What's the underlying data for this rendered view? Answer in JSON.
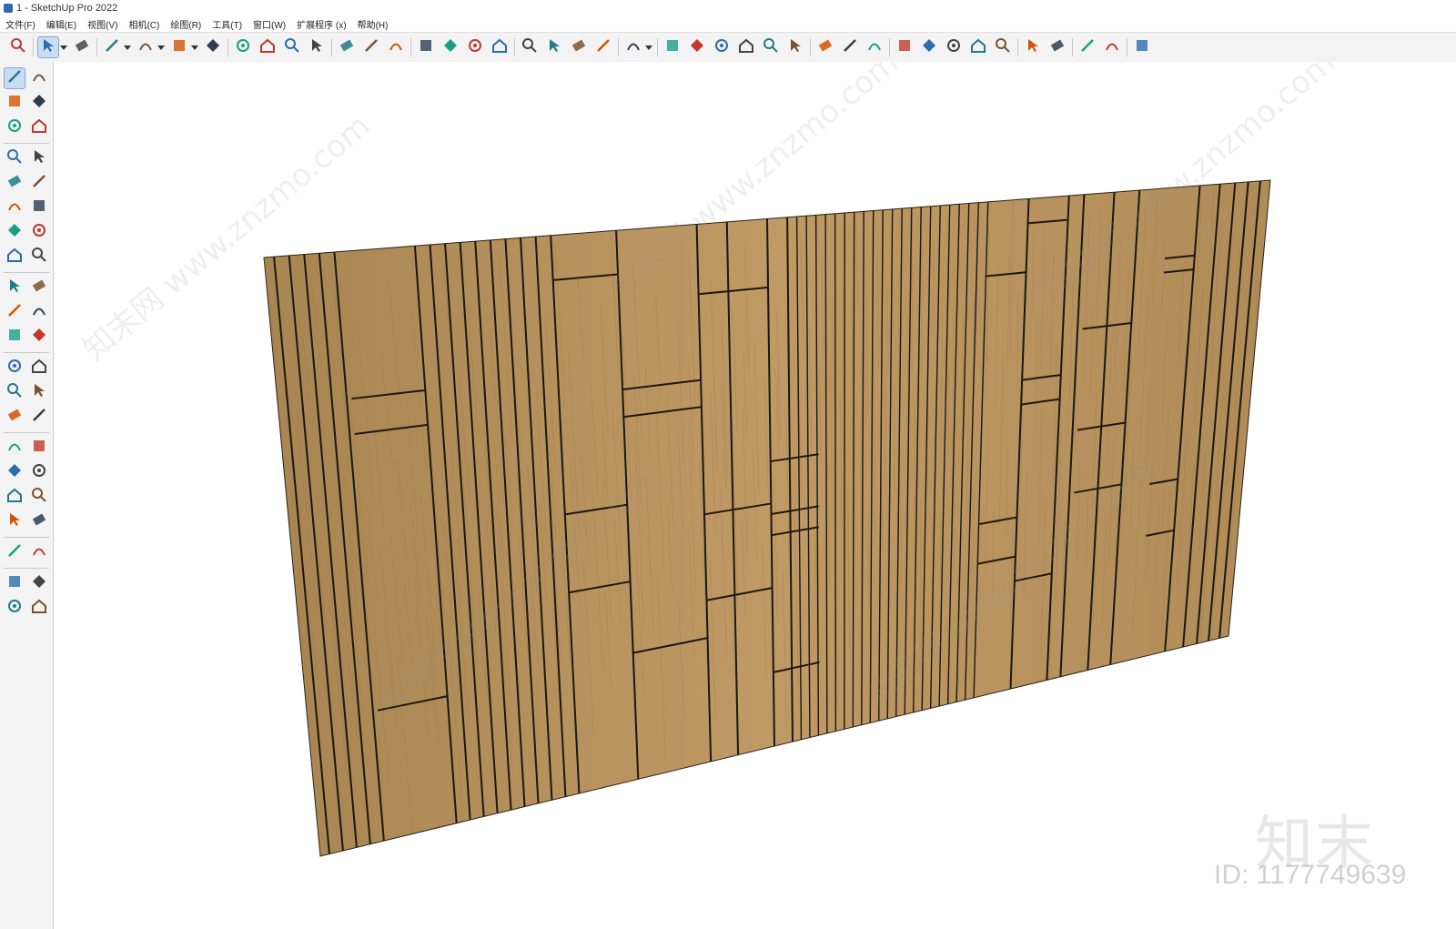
{
  "window": {
    "title": "1 - SketchUp Pro 2022"
  },
  "menu": [
    "文件(F)",
    "编辑(E)",
    "视图(V)",
    "相机(C)",
    "绘图(R)",
    "工具(T)",
    "窗口(W)",
    "扩展程序 (x)",
    "帮助(H)"
  ],
  "toolbar": {
    "icons": [
      "zoom-extents-icon",
      "select-icon",
      "eraser-icon",
      "line-icon",
      "arc-icon",
      "rectangle-icon",
      "push-pull-icon",
      "follow-me-icon",
      "move-icon",
      "rotate-icon",
      "scale-icon",
      "tape-measure-icon",
      "text-icon",
      "paint-bucket-icon",
      "orbit-icon",
      "pan-icon",
      "zoom-icon",
      "zoom-window-icon",
      "components-icon",
      "styles-icon",
      "layers-icon",
      "scenes-icon",
      "account-icon",
      "iso-view-icon",
      "front-view-icon",
      "home-view-icon",
      "top-view-icon",
      "house-icon",
      "box-icon",
      "solid-tools-icon",
      "outer-shell-icon",
      "intersect-icon",
      "add-location-icon",
      "sandbox-icon",
      "photo-texture-icon",
      "shadow-icon",
      "cloud-icon",
      "extension-manager-icon",
      "section-icon",
      "info-icon",
      "warehouse-icon",
      "user-icon"
    ]
  },
  "left_toolbar": {
    "icons": [
      "select-icon",
      "orbit-icon",
      "paint-icon",
      "eraser-icon",
      "components-icon",
      "tag-icon",
      "pencil-icon",
      "freehand-icon",
      "rectangle-icon",
      "rotated-rect-icon",
      "circle-icon",
      "polygon-icon",
      "arc-icon",
      "pie-icon",
      "two-point-arc-icon",
      "three-point-arc-icon",
      "move-icon",
      "push-pull-icon",
      "rotate-icon",
      "follow-me-icon",
      "scale-icon",
      "offset-icon",
      "tape-measure-icon",
      "dimension-icon",
      "protractor-icon",
      "text-icon",
      "axes-icon",
      "three-d-text-icon",
      "orbit-nav-icon",
      "pan-nav-icon",
      "zoom-nav-icon",
      "zoom-window-nav-icon",
      "zoom-extents-nav-icon",
      "previous-view-icon",
      "position-camera-icon",
      "look-around-icon",
      "walk-icon",
      "section-plane-icon",
      "warehouse-left-icon",
      "styles-left-icon",
      "layers-left-icon",
      "scenes-left-icon"
    ]
  },
  "model": {
    "panel_color": "#b8935e",
    "groove_color": "#1d1710",
    "texture_dark": "#9c7a4a"
  },
  "watermark": {
    "logo_text": "知末",
    "id_text": "ID: 1177749639",
    "diagonal_text": "知末网 www.znzmo.com"
  }
}
